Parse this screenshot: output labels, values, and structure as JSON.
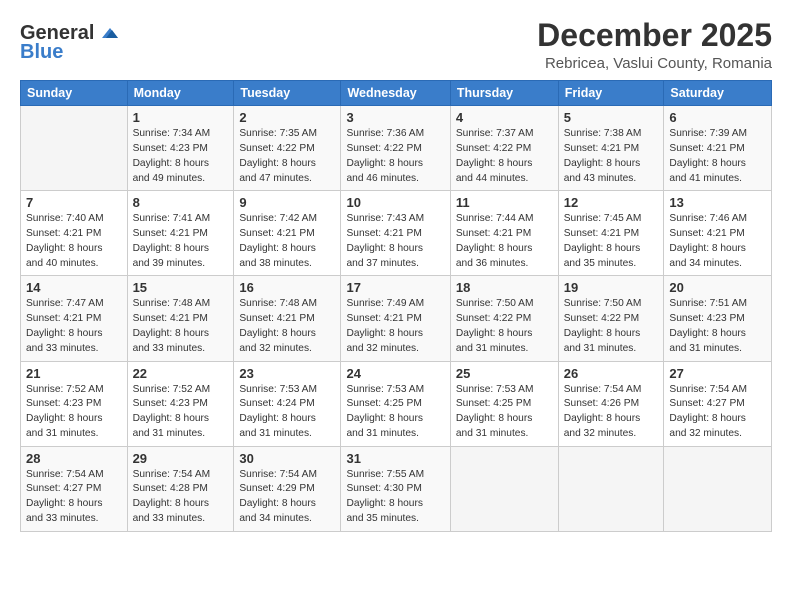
{
  "logo": {
    "general": "General",
    "blue": "Blue",
    "tagline": ""
  },
  "header": {
    "title": "December 2025",
    "subtitle": "Rebricea, Vaslui County, Romania"
  },
  "calendar": {
    "days_of_week": [
      "Sunday",
      "Monday",
      "Tuesday",
      "Wednesday",
      "Thursday",
      "Friday",
      "Saturday"
    ],
    "weeks": [
      [
        {
          "day": "",
          "detail": ""
        },
        {
          "day": "1",
          "detail": "Sunrise: 7:34 AM\nSunset: 4:23 PM\nDaylight: 8 hours\nand 49 minutes."
        },
        {
          "day": "2",
          "detail": "Sunrise: 7:35 AM\nSunset: 4:22 PM\nDaylight: 8 hours\nand 47 minutes."
        },
        {
          "day": "3",
          "detail": "Sunrise: 7:36 AM\nSunset: 4:22 PM\nDaylight: 8 hours\nand 46 minutes."
        },
        {
          "day": "4",
          "detail": "Sunrise: 7:37 AM\nSunset: 4:22 PM\nDaylight: 8 hours\nand 44 minutes."
        },
        {
          "day": "5",
          "detail": "Sunrise: 7:38 AM\nSunset: 4:21 PM\nDaylight: 8 hours\nand 43 minutes."
        },
        {
          "day": "6",
          "detail": "Sunrise: 7:39 AM\nSunset: 4:21 PM\nDaylight: 8 hours\nand 41 minutes."
        }
      ],
      [
        {
          "day": "7",
          "detail": "Sunrise: 7:40 AM\nSunset: 4:21 PM\nDaylight: 8 hours\nand 40 minutes."
        },
        {
          "day": "8",
          "detail": "Sunrise: 7:41 AM\nSunset: 4:21 PM\nDaylight: 8 hours\nand 39 minutes."
        },
        {
          "day": "9",
          "detail": "Sunrise: 7:42 AM\nSunset: 4:21 PM\nDaylight: 8 hours\nand 38 minutes."
        },
        {
          "day": "10",
          "detail": "Sunrise: 7:43 AM\nSunset: 4:21 PM\nDaylight: 8 hours\nand 37 minutes."
        },
        {
          "day": "11",
          "detail": "Sunrise: 7:44 AM\nSunset: 4:21 PM\nDaylight: 8 hours\nand 36 minutes."
        },
        {
          "day": "12",
          "detail": "Sunrise: 7:45 AM\nSunset: 4:21 PM\nDaylight: 8 hours\nand 35 minutes."
        },
        {
          "day": "13",
          "detail": "Sunrise: 7:46 AM\nSunset: 4:21 PM\nDaylight: 8 hours\nand 34 minutes."
        }
      ],
      [
        {
          "day": "14",
          "detail": "Sunrise: 7:47 AM\nSunset: 4:21 PM\nDaylight: 8 hours\nand 33 minutes."
        },
        {
          "day": "15",
          "detail": "Sunrise: 7:48 AM\nSunset: 4:21 PM\nDaylight: 8 hours\nand 33 minutes."
        },
        {
          "day": "16",
          "detail": "Sunrise: 7:48 AM\nSunset: 4:21 PM\nDaylight: 8 hours\nand 32 minutes."
        },
        {
          "day": "17",
          "detail": "Sunrise: 7:49 AM\nSunset: 4:21 PM\nDaylight: 8 hours\nand 32 minutes."
        },
        {
          "day": "18",
          "detail": "Sunrise: 7:50 AM\nSunset: 4:22 PM\nDaylight: 8 hours\nand 31 minutes."
        },
        {
          "day": "19",
          "detail": "Sunrise: 7:50 AM\nSunset: 4:22 PM\nDaylight: 8 hours\nand 31 minutes."
        },
        {
          "day": "20",
          "detail": "Sunrise: 7:51 AM\nSunset: 4:23 PM\nDaylight: 8 hours\nand 31 minutes."
        }
      ],
      [
        {
          "day": "21",
          "detail": "Sunrise: 7:52 AM\nSunset: 4:23 PM\nDaylight: 8 hours\nand 31 minutes."
        },
        {
          "day": "22",
          "detail": "Sunrise: 7:52 AM\nSunset: 4:23 PM\nDaylight: 8 hours\nand 31 minutes."
        },
        {
          "day": "23",
          "detail": "Sunrise: 7:53 AM\nSunset: 4:24 PM\nDaylight: 8 hours\nand 31 minutes."
        },
        {
          "day": "24",
          "detail": "Sunrise: 7:53 AM\nSunset: 4:25 PM\nDaylight: 8 hours\nand 31 minutes."
        },
        {
          "day": "25",
          "detail": "Sunrise: 7:53 AM\nSunset: 4:25 PM\nDaylight: 8 hours\nand 31 minutes."
        },
        {
          "day": "26",
          "detail": "Sunrise: 7:54 AM\nSunset: 4:26 PM\nDaylight: 8 hours\nand 32 minutes."
        },
        {
          "day": "27",
          "detail": "Sunrise: 7:54 AM\nSunset: 4:27 PM\nDaylight: 8 hours\nand 32 minutes."
        }
      ],
      [
        {
          "day": "28",
          "detail": "Sunrise: 7:54 AM\nSunset: 4:27 PM\nDaylight: 8 hours\nand 33 minutes."
        },
        {
          "day": "29",
          "detail": "Sunrise: 7:54 AM\nSunset: 4:28 PM\nDaylight: 8 hours\nand 33 minutes."
        },
        {
          "day": "30",
          "detail": "Sunrise: 7:54 AM\nSunset: 4:29 PM\nDaylight: 8 hours\nand 34 minutes."
        },
        {
          "day": "31",
          "detail": "Sunrise: 7:55 AM\nSunset: 4:30 PM\nDaylight: 8 hours\nand 35 minutes."
        },
        {
          "day": "",
          "detail": ""
        },
        {
          "day": "",
          "detail": ""
        },
        {
          "day": "",
          "detail": ""
        }
      ]
    ]
  }
}
